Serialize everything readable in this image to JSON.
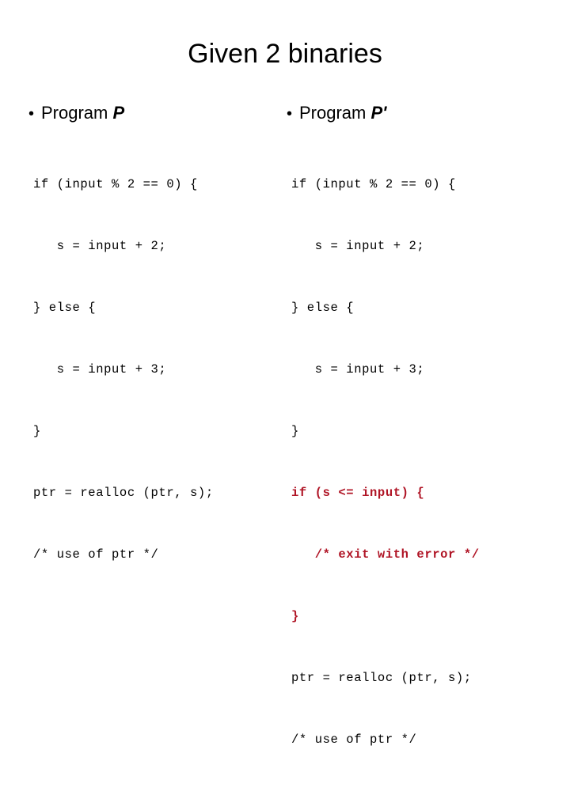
{
  "slide": {
    "title": "Given 2 binaries",
    "background_color": "#ffffff",
    "text_color": "#000000",
    "highlight_color": "#b01526"
  },
  "columns": [
    {
      "bullet_glyph": "•",
      "heading_prefix": "Program ",
      "heading_symbol": "P",
      "code_lines": [
        {
          "text": "if (input % 2 == 0) {",
          "highlight": false
        },
        {
          "text": "   s = input + 2;",
          "highlight": false
        },
        {
          "text": "} else {",
          "highlight": false
        },
        {
          "text": "   s = input + 3;",
          "highlight": false
        },
        {
          "text": "}",
          "highlight": false
        },
        {
          "text": "ptr = realloc (ptr, s);",
          "highlight": false
        },
        {
          "text": "/* use of ptr */",
          "highlight": false
        }
      ]
    },
    {
      "bullet_glyph": "•",
      "heading_prefix": "Program ",
      "heading_symbol": "P'",
      "code_lines": [
        {
          "text": "if (input % 2 == 0) {",
          "highlight": false
        },
        {
          "text": "   s = input + 2;",
          "highlight": false
        },
        {
          "text": "} else {",
          "highlight": false
        },
        {
          "text": "   s = input + 3;",
          "highlight": false
        },
        {
          "text": "}",
          "highlight": false
        },
        {
          "text": "if (s <= input) {",
          "highlight": true
        },
        {
          "text": "   /* exit with error */",
          "highlight": true
        },
        {
          "text": "}",
          "highlight": true
        },
        {
          "text": "ptr = realloc (ptr, s);",
          "highlight": false
        },
        {
          "text": "/* use of ptr */",
          "highlight": false
        }
      ]
    }
  ]
}
